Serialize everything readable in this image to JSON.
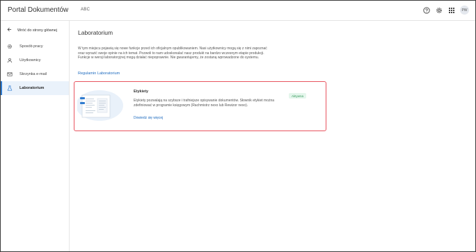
{
  "header": {
    "app_title": "Portal Dokumentów",
    "tenant": "ABC",
    "avatar_initials": "PW",
    "icons": [
      "help-icon",
      "settings-gear-icon",
      "apps-grid-icon"
    ]
  },
  "sidebar": {
    "back_label": "Wróć do strony głównej",
    "items": [
      {
        "label": "Sposób pracy",
        "icon": "gear-icon"
      },
      {
        "label": "Użytkownicy",
        "icon": "users-icon"
      },
      {
        "label": "Skrzynka e-mail",
        "icon": "mail-icon"
      },
      {
        "label": "Laboratorium",
        "icon": "flask-icon",
        "active": true
      }
    ]
  },
  "main": {
    "title": "Laboratorium",
    "description": "W tym miejscu pojawią się nowe funkcje przed ich oficjalnym opublikowaniem. Nasi użytkownicy mogą się z nimi zapoznać oraz wyrazić swoje opinie na ich temat. Pozwoli to nam udoskonalać nasz produkt na bardzo wczesnym etapie produkcji. Funkcje w wersji laboratoryjnej mogą działać niepoprawnie. Nie gwarantujemy, że zostaną wprowadzone do systemu.",
    "regulations_link": "Regulamin Laboratorium",
    "feature_card": {
      "title": "Etykiety",
      "description": "Etykiety pozwalają na szybsze i trafniejsze opisywanie dokumentów. Słownik etykiet można zdefiniować w programie księgowym (Rachmistrz nexo lub Rewizor nexo).",
      "link": "Dowiedz się więcej",
      "status_badge": "Aktywna"
    }
  },
  "colors": {
    "accent": "#1e6bbf",
    "active_nav_bg": "#eaf2fb",
    "card_highlight_border": "#e8535e",
    "badge_bg": "#e4f6ec",
    "badge_text": "#3a9a5e"
  }
}
